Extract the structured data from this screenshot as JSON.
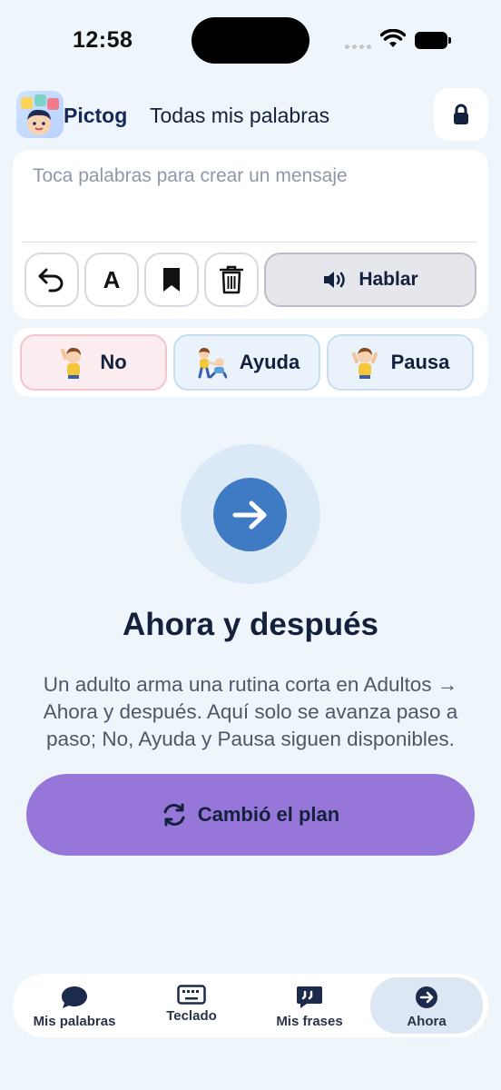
{
  "status_bar": {
    "time": "12:58"
  },
  "header": {
    "brand": "Pictog",
    "title": "Todas mis palabras",
    "lock_icon": "lock-icon"
  },
  "message": {
    "placeholder": "Toca palabras para crear un mensaje"
  },
  "toolbar": {
    "undo_icon": "undo-icon",
    "case_label": "A",
    "bookmark_icon": "bookmark-icon",
    "delete_icon": "trash-icon",
    "speak_label": "Hablar",
    "speak_icon": "speaker-icon"
  },
  "quick_actions": [
    {
      "label": "No",
      "icon": "boy-raising-hand-icon"
    },
    {
      "label": "Ayuda",
      "icon": "helping-kids-icon"
    },
    {
      "label": "Pausa",
      "icon": "boy-hands-up-icon"
    }
  ],
  "hero": {
    "icon": "arrow-right-icon",
    "title": "Ahora y después",
    "description": "Un adulto arma una rutina corta en Adultos → Ahora y después. Aquí solo se avanza paso a paso; No, Ayuda y Pausa siguen disponibles."
  },
  "plan_button": {
    "label": "Cambió el plan",
    "icon": "refresh-icon"
  },
  "bottom_nav": [
    {
      "label": "Mis palabras",
      "icon": "chat-bubble-icon"
    },
    {
      "label": "Teclado",
      "icon": "keyboard-icon"
    },
    {
      "label": "Mis frases",
      "icon": "quote-bubble-icon"
    },
    {
      "label": "Ahora",
      "icon": "arrow-circle-icon",
      "active": true
    }
  ],
  "colors": {
    "background": "#eff6fb",
    "accent_blue": "#3f7bc4",
    "plan_purple": "#9677d9",
    "no_pink": "#fbecf0",
    "text_dark": "#14213d"
  }
}
